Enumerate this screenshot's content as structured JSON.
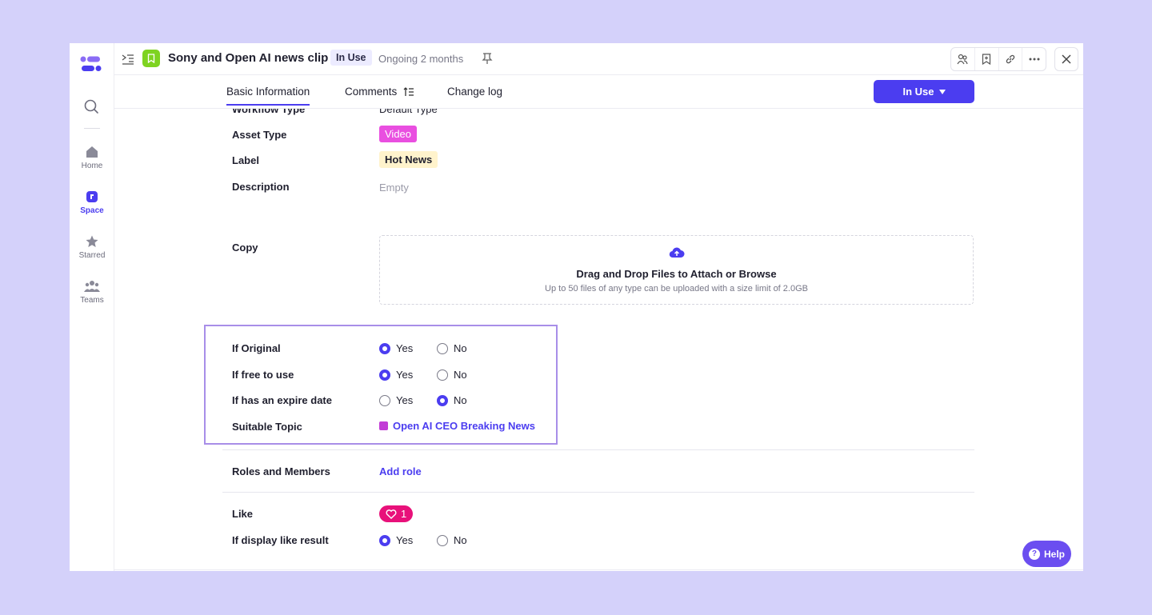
{
  "nav": {
    "home": "Home",
    "space": "Space",
    "starred": "Starred",
    "teams": "Teams"
  },
  "header": {
    "title": "Sony and Open AI news clip",
    "status": "In Use",
    "duration": "Ongoing 2 months"
  },
  "tabs": {
    "basic": "Basic Information",
    "comments": "Comments",
    "changelog": "Change log"
  },
  "status_button": "In Use",
  "fields": {
    "workflow_label": "Workflow Type",
    "workflow_value": "Default Type",
    "asset_label": "Asset Type",
    "asset_value": "Video",
    "label_label": "Label",
    "label_value": "Hot News",
    "desc_label": "Description",
    "desc_value": "Empty",
    "copy_label": "Copy",
    "upload_title": "Drag and Drop Files to Attach or Browse",
    "upload_sub": "Up to 50 files of any type can be uploaded with a size limit of 2.0GB",
    "original_label": "If Original",
    "free_label": "If free to use",
    "expire_label": "If has an expire date",
    "topic_label": "Suitable Topic",
    "topic_value": "Open AI CEO Breaking News",
    "roles_label": "Roles and Members",
    "roles_value": "Add role",
    "like_label": "Like",
    "like_count": "1",
    "display_like_label": "If display like result",
    "yes": "Yes",
    "no": "No"
  },
  "help": "Help",
  "colors": {
    "accent": "#4b3df0",
    "background": "#d4d1fa",
    "video_tag": "#e94fe0",
    "like": "#e8117a"
  }
}
